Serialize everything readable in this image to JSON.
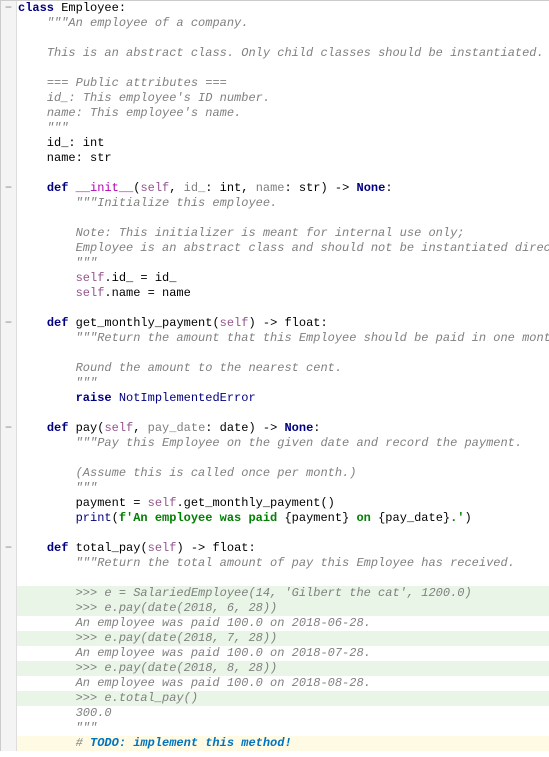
{
  "lines": [
    {
      "g": "minus",
      "cls": "",
      "segs": [
        {
          "c": "kw",
          "t": "class "
        },
        {
          "c": "cls",
          "t": "Employee:"
        }
      ]
    },
    {
      "g": "",
      "cls": "",
      "segs": [
        {
          "c": "",
          "t": "    "
        },
        {
          "c": "docstr",
          "t": "\"\"\"An employee of a company."
        }
      ]
    },
    {
      "g": "",
      "cls": "",
      "segs": [
        {
          "c": "",
          "t": ""
        }
      ]
    },
    {
      "g": "",
      "cls": "",
      "segs": [
        {
          "c": "",
          "t": "    "
        },
        {
          "c": "docstr",
          "t": "This is an abstract class. Only child classes should be instantiated."
        }
      ]
    },
    {
      "g": "",
      "cls": "",
      "segs": [
        {
          "c": "",
          "t": ""
        }
      ]
    },
    {
      "g": "",
      "cls": "",
      "segs": [
        {
          "c": "",
          "t": "    "
        },
        {
          "c": "docstr",
          "t": "=== Public attributes ==="
        }
      ]
    },
    {
      "g": "",
      "cls": "",
      "segs": [
        {
          "c": "",
          "t": "    "
        },
        {
          "c": "docstr",
          "t": "id_: This employee's ID number."
        }
      ]
    },
    {
      "g": "",
      "cls": "",
      "segs": [
        {
          "c": "",
          "t": "    "
        },
        {
          "c": "docstr",
          "t": "name: This employee's name."
        }
      ]
    },
    {
      "g": "",
      "cls": "",
      "segs": [
        {
          "c": "",
          "t": "    "
        },
        {
          "c": "docstr",
          "t": "\"\"\""
        }
      ]
    },
    {
      "g": "",
      "cls": "",
      "segs": [
        {
          "c": "",
          "t": "    id_: int"
        }
      ]
    },
    {
      "g": "",
      "cls": "",
      "segs": [
        {
          "c": "",
          "t": "    name: str"
        }
      ]
    },
    {
      "g": "",
      "cls": "",
      "segs": [
        {
          "c": "",
          "t": ""
        }
      ]
    },
    {
      "g": "minus",
      "cls": "",
      "segs": [
        {
          "c": "",
          "t": "    "
        },
        {
          "c": "kw",
          "t": "def "
        },
        {
          "c": "dunder",
          "t": "__init__"
        },
        {
          "c": "",
          "t": "("
        },
        {
          "c": "selfkw",
          "t": "self"
        },
        {
          "c": "",
          "t": ", "
        },
        {
          "c": "param",
          "t": "id_"
        },
        {
          "c": "",
          "t": ": int, "
        },
        {
          "c": "param",
          "t": "name"
        },
        {
          "c": "",
          "t": ": str) -> "
        },
        {
          "c": "kw",
          "t": "None"
        },
        {
          "c": "",
          "t": ":"
        }
      ]
    },
    {
      "g": "",
      "cls": "",
      "segs": [
        {
          "c": "",
          "t": "        "
        },
        {
          "c": "docstr",
          "t": "\"\"\"Initialize this employee."
        }
      ]
    },
    {
      "g": "",
      "cls": "",
      "segs": [
        {
          "c": "",
          "t": ""
        }
      ]
    },
    {
      "g": "",
      "cls": "",
      "segs": [
        {
          "c": "",
          "t": "        "
        },
        {
          "c": "docstr",
          "t": "Note: This initializer is meant for internal use only;"
        }
      ]
    },
    {
      "g": "",
      "cls": "",
      "segs": [
        {
          "c": "",
          "t": "        "
        },
        {
          "c": "docstr",
          "t": "Employee is an abstract class and should not be instantiated directly."
        }
      ]
    },
    {
      "g": "",
      "cls": "",
      "segs": [
        {
          "c": "",
          "t": "        "
        },
        {
          "c": "docstr",
          "t": "\"\"\""
        }
      ]
    },
    {
      "g": "",
      "cls": "",
      "segs": [
        {
          "c": "",
          "t": "        "
        },
        {
          "c": "selfkw",
          "t": "self"
        },
        {
          "c": "",
          "t": ".id_ = id_"
        }
      ]
    },
    {
      "g": "",
      "cls": "",
      "segs": [
        {
          "c": "",
          "t": "        "
        },
        {
          "c": "selfkw",
          "t": "self"
        },
        {
          "c": "",
          "t": ".name = name"
        }
      ]
    },
    {
      "g": "",
      "cls": "",
      "segs": [
        {
          "c": "",
          "t": ""
        }
      ]
    },
    {
      "g": "minus",
      "cls": "",
      "segs": [
        {
          "c": "",
          "t": "    "
        },
        {
          "c": "kw",
          "t": "def "
        },
        {
          "c": "fn",
          "t": "get_monthly_payment"
        },
        {
          "c": "",
          "t": "("
        },
        {
          "c": "selfkw",
          "t": "self"
        },
        {
          "c": "",
          "t": ") -> float:"
        }
      ]
    },
    {
      "g": "",
      "cls": "",
      "segs": [
        {
          "c": "",
          "t": "        "
        },
        {
          "c": "docstr",
          "t": "\"\"\"Return the amount that this Employee should be paid in one month."
        }
      ]
    },
    {
      "g": "",
      "cls": "",
      "segs": [
        {
          "c": "",
          "t": ""
        }
      ]
    },
    {
      "g": "",
      "cls": "",
      "segs": [
        {
          "c": "",
          "t": "        "
        },
        {
          "c": "docstr",
          "t": "Round the amount to the nearest cent."
        }
      ]
    },
    {
      "g": "",
      "cls": "",
      "segs": [
        {
          "c": "",
          "t": "        "
        },
        {
          "c": "docstr",
          "t": "\"\"\""
        }
      ]
    },
    {
      "g": "",
      "cls": "",
      "segs": [
        {
          "c": "",
          "t": "        "
        },
        {
          "c": "kw",
          "t": "raise "
        },
        {
          "c": "err",
          "t": "NotImplementedError"
        }
      ]
    },
    {
      "g": "",
      "cls": "",
      "segs": [
        {
          "c": "",
          "t": ""
        }
      ]
    },
    {
      "g": "minus",
      "cls": "",
      "segs": [
        {
          "c": "",
          "t": "    "
        },
        {
          "c": "kw",
          "t": "def "
        },
        {
          "c": "fn",
          "t": "pay"
        },
        {
          "c": "",
          "t": "("
        },
        {
          "c": "selfkw",
          "t": "self"
        },
        {
          "c": "",
          "t": ", "
        },
        {
          "c": "param",
          "t": "pay_date"
        },
        {
          "c": "",
          "t": ": date) -> "
        },
        {
          "c": "kw",
          "t": "None"
        },
        {
          "c": "",
          "t": ":"
        }
      ]
    },
    {
      "g": "",
      "cls": "",
      "segs": [
        {
          "c": "",
          "t": "        "
        },
        {
          "c": "docstr",
          "t": "\"\"\"Pay this Employee on the given date and record the payment."
        }
      ]
    },
    {
      "g": "",
      "cls": "",
      "segs": [
        {
          "c": "",
          "t": ""
        }
      ]
    },
    {
      "g": "",
      "cls": "",
      "segs": [
        {
          "c": "",
          "t": "        "
        },
        {
          "c": "docstr",
          "t": "(Assume this is called once per month.)"
        }
      ]
    },
    {
      "g": "",
      "cls": "",
      "segs": [
        {
          "c": "",
          "t": "        "
        },
        {
          "c": "docstr",
          "t": "\"\"\""
        }
      ]
    },
    {
      "g": "",
      "cls": "",
      "segs": [
        {
          "c": "",
          "t": "        payment = "
        },
        {
          "c": "selfkw",
          "t": "self"
        },
        {
          "c": "",
          "t": ".get_monthly_payment()"
        }
      ]
    },
    {
      "g": "",
      "cls": "",
      "segs": [
        {
          "c": "",
          "t": "        "
        },
        {
          "c": "builtin",
          "t": "print"
        },
        {
          "c": "",
          "t": "("
        },
        {
          "c": "fstring",
          "t": "f'An employee was paid "
        },
        {
          "c": "",
          "t": "{payment}"
        },
        {
          "c": "fstring",
          "t": " on "
        },
        {
          "c": "",
          "t": "{pay_date}"
        },
        {
          "c": "fstring",
          "t": ".'"
        },
        {
          "c": "",
          "t": ")"
        }
      ]
    },
    {
      "g": "",
      "cls": "",
      "segs": [
        {
          "c": "",
          "t": ""
        }
      ]
    },
    {
      "g": "minus",
      "cls": "",
      "segs": [
        {
          "c": "",
          "t": "    "
        },
        {
          "c": "kw",
          "t": "def "
        },
        {
          "c": "fn",
          "t": "total_pay"
        },
        {
          "c": "",
          "t": "("
        },
        {
          "c": "selfkw",
          "t": "self"
        },
        {
          "c": "",
          "t": ") -> float:"
        }
      ]
    },
    {
      "g": "",
      "cls": "",
      "segs": [
        {
          "c": "",
          "t": "        "
        },
        {
          "c": "docstr",
          "t": "\"\"\"Return the total amount of pay this Employee has received."
        }
      ]
    },
    {
      "g": "",
      "cls": "",
      "segs": [
        {
          "c": "",
          "t": ""
        }
      ]
    },
    {
      "g": "",
      "cls": "hl-green",
      "segs": [
        {
          "c": "",
          "t": "        "
        },
        {
          "c": "docstr",
          "t": ">>> e = SalariedEmployee(14, 'Gilbert the cat', 1200.0)"
        }
      ]
    },
    {
      "g": "",
      "cls": "hl-green",
      "segs": [
        {
          "c": "",
          "t": "        "
        },
        {
          "c": "docstr",
          "t": ">>> e.pay(date(2018, 6, 28))"
        }
      ]
    },
    {
      "g": "",
      "cls": "",
      "segs": [
        {
          "c": "",
          "t": "        "
        },
        {
          "c": "docstr",
          "t": "An employee was paid 100.0 on 2018-06-28."
        }
      ]
    },
    {
      "g": "",
      "cls": "hl-green",
      "segs": [
        {
          "c": "",
          "t": "        "
        },
        {
          "c": "docstr",
          "t": ">>> e.pay(date(2018, 7, 28))"
        }
      ]
    },
    {
      "g": "",
      "cls": "",
      "segs": [
        {
          "c": "",
          "t": "        "
        },
        {
          "c": "docstr",
          "t": "An employee was paid 100.0 on 2018-07-28."
        }
      ]
    },
    {
      "g": "",
      "cls": "hl-green",
      "segs": [
        {
          "c": "",
          "t": "        "
        },
        {
          "c": "docstr",
          "t": ">>> e.pay(date(2018, 8, 28))"
        }
      ]
    },
    {
      "g": "",
      "cls": "",
      "segs": [
        {
          "c": "",
          "t": "        "
        },
        {
          "c": "docstr",
          "t": "An employee was paid 100.0 on 2018-08-28."
        }
      ]
    },
    {
      "g": "",
      "cls": "hl-green",
      "segs": [
        {
          "c": "",
          "t": "        "
        },
        {
          "c": "docstr",
          "t": ">>> e.total_pay()"
        }
      ]
    },
    {
      "g": "",
      "cls": "",
      "segs": [
        {
          "c": "",
          "t": "        "
        },
        {
          "c": "docstr",
          "t": "300.0"
        }
      ]
    },
    {
      "g": "",
      "cls": "",
      "segs": [
        {
          "c": "",
          "t": "        "
        },
        {
          "c": "docstr",
          "t": "\"\"\""
        }
      ]
    },
    {
      "g": "",
      "cls": "hl-cream",
      "segs": [
        {
          "c": "",
          "t": "        "
        },
        {
          "c": "comment",
          "t": "# "
        },
        {
          "c": "todo",
          "t": "TODO: implement this method!"
        }
      ]
    }
  ]
}
